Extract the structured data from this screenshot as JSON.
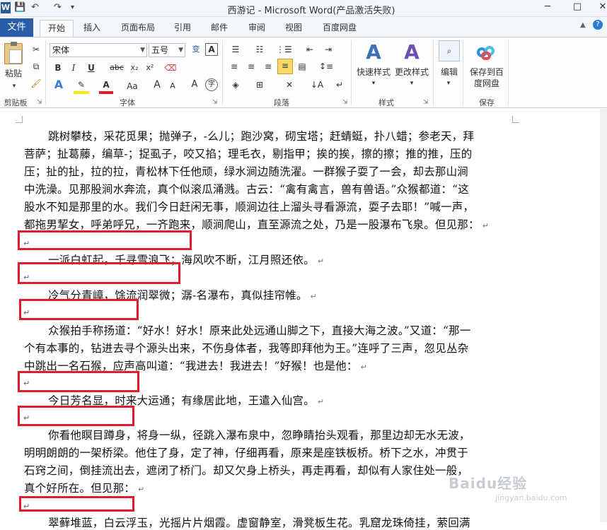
{
  "window": {
    "title": "西游记 - Microsoft Word(产品激活失败)",
    "app_icon_letter": "W",
    "qat": [
      "💾",
      "↶",
      "↷",
      "▾"
    ],
    "controls": [
      "─",
      "□",
      "✕"
    ]
  },
  "tabs": {
    "file": "文件",
    "items": [
      "开始",
      "插入",
      "页面布局",
      "引用",
      "邮件",
      "审阅",
      "视图",
      "百度网盘"
    ],
    "active_index": 0
  },
  "ribbon": {
    "clipboard": {
      "label": "剪贴板",
      "paste": "粘贴"
    },
    "font": {
      "label": "字体",
      "font_name": "宋体",
      "font_size": "五号",
      "bold": "B",
      "italic": "I",
      "underline": "U",
      "strike": "abc",
      "subscript": "x₂",
      "superscript": "x²",
      "grow": "A",
      "shrink": "A",
      "aa": "Aa",
      "case": "Aa",
      "wen": "变",
      "A_box": "A"
    },
    "paragraph": {
      "label": "段落"
    },
    "styles": {
      "label": "样式",
      "quick": "快速样式",
      "change": "更改样式"
    },
    "editing": {
      "label": "编辑"
    },
    "save": {
      "label": "保存",
      "button_line1": "保存到百",
      "button_line2": "度网盘"
    }
  },
  "document": {
    "lines": [
      "跳树攀枝，采花觅果；抛弹子，-么儿；跑沙窝，砌宝塔；赶蜻蜓，扑八蜡；参老天，拜",
      "菩萨；扯葛藤，编草-；捉虱子，咬又掐；理毛衣，剔指甲；挨的挨，擦的擦；推的推，压的",
      "压；扯的扯，拉的拉，青松林下任他顽，绿水涧边随洗濯。一群猴子耍了一会，却去那山涧",
      "中洗澡。见那股涧水奔流，真个似滚瓜涌溅。古云：“禽有禽言，兽有兽语。”众猴都道：“这",
      "股水不知是那里的水。我们今日赶闲无事，顺涧边往上溜头寻看源流，耍子去耶！”喊一声，",
      "都拖男挈女，呼弟呼兄，一齐跑来，顺涧爬山，直至源流之处，乃是一股瀑布飞泉。但见那：",
      "一派白虹起，千寻雪浪飞；海风吹不断，江月照还依。",
      "冷气分青嶂，馀流润翠微；潺-名瀑布，真似挂帘帷。",
      "众猴拍手称扬道：“好水！好水！原来此处远通山脚之下，直接大海之波。”又道：“那一",
      "个有本事的，钻进去寻个源头出来，不伤身体者，我等即拜他为王。”连呼了三声，忽见丛杂",
      "中跳出一名石猴，应声高叫道：“我进去！我进去！”好猴！也是他：",
      "今日芳名显，时来大运通；有缘居此地，王遣入仙宫。",
      "你看他瞑目蹲身，将身一纵，径跳入瀑布泉中，忽睁睛抬头观看，那里边却无水无波，",
      "明明朗朗的一架桥梁。他住了身，定了神，仔细再看，原来是座铁板桥。桥下之水，冲贯于",
      "石窍之间，倒挂流出去，遮闭了桥门。却又欠身上桥头，再走再看，却似有人家住处一般，",
      "真个好所在。但见那：",
      "翠藓堆蓝，白云浮玉，光摇片片烟霞。虚窗静室，滑凳板生花。乳窟龙珠倚挂，萦回满"
    ],
    "para_mark": "↵",
    "empty_mark": "↵"
  },
  "watermark": {
    "main": "Baidu经验",
    "sub": "jingyan.baidu.com"
  }
}
